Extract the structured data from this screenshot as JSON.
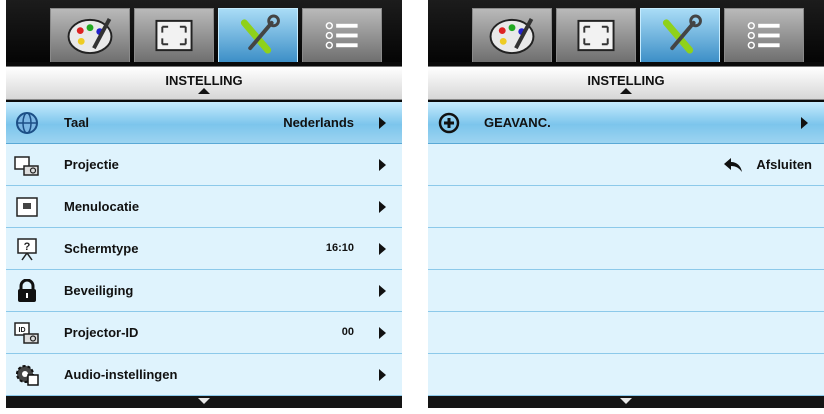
{
  "left_menu": {
    "title": "INSTELLING",
    "tabs": [
      {
        "name": "image-settings",
        "icon": "palette-icon"
      },
      {
        "name": "display",
        "icon": "fullscreen-icon"
      },
      {
        "name": "setup",
        "icon": "tools-icon",
        "active": true
      },
      {
        "name": "options",
        "icon": "list-icon"
      }
    ],
    "items": [
      {
        "label": "Taal",
        "value": "Nederlands",
        "icon": "globe-icon",
        "selected": true
      },
      {
        "label": "Projectie",
        "value": "",
        "icon": "projection-icon"
      },
      {
        "label": "Menulocatie",
        "value": "",
        "icon": "menu-location-icon"
      },
      {
        "label": "Schermtype",
        "value": "16:10",
        "icon": "screen-type-icon"
      },
      {
        "label": "Beveiliging",
        "value": "",
        "icon": "lock-icon"
      },
      {
        "label": "Projector-ID",
        "value": "00",
        "icon": "projector-id-icon"
      },
      {
        "label": "Audio-instellingen",
        "value": "",
        "icon": "audio-settings-icon"
      }
    ]
  },
  "right_menu": {
    "title": "INSTELLING",
    "items": [
      {
        "label": "GEAVANC.",
        "icon": "plus-circle-icon",
        "selected": true
      }
    ],
    "exit_label": "Afsluiten",
    "exit_icon": "back-arrow-icon"
  },
  "colors": {
    "selected_row": "#7cc5ec",
    "row": "#dff3fd",
    "active_tab": "#3d8fc7"
  }
}
